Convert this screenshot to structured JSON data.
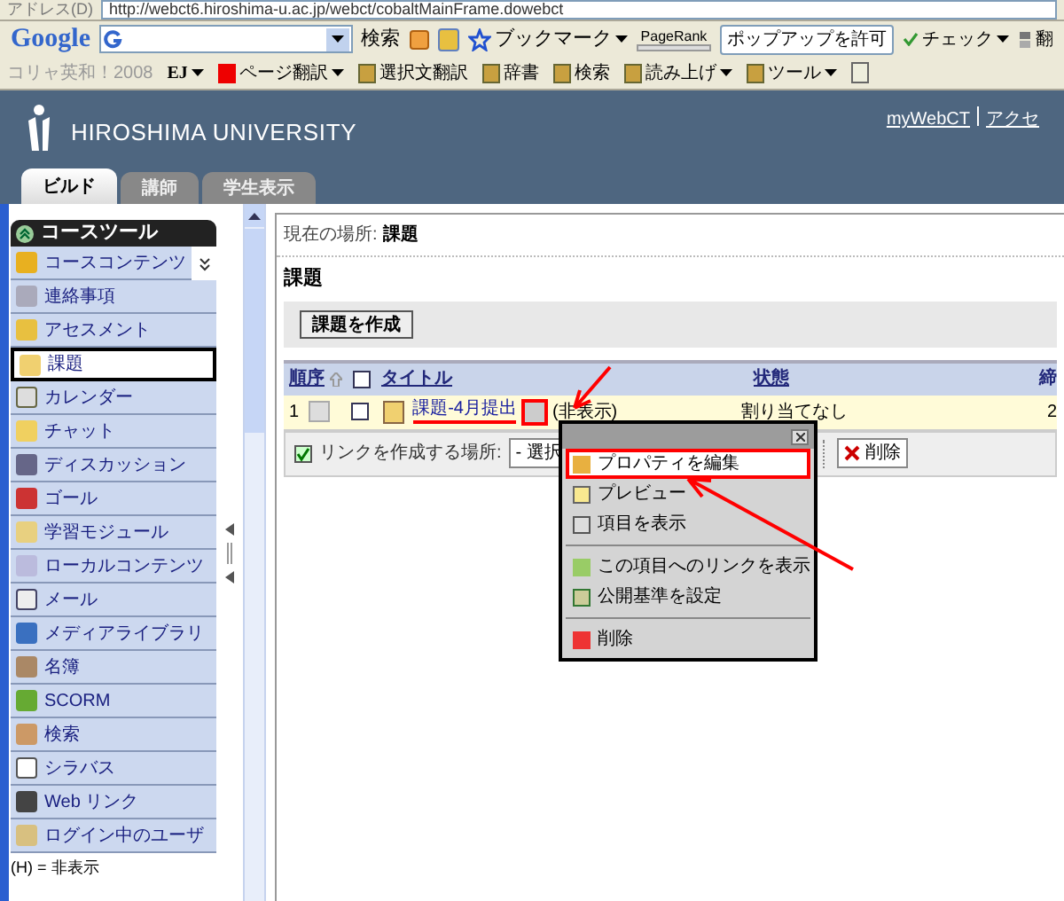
{
  "browser": {
    "address_label": "アドレス(D)",
    "url": "http://webct6.hiroshima-u.ac.jp/webct/cobaltMainFrame.dowebct"
  },
  "google_toolbar": {
    "logo": "Google",
    "search_button": "検索",
    "bookmarks": "ブックマーク",
    "pagerank": "PageRank",
    "popup_button": "ポップアップを許可",
    "check": "チェック",
    "translate": "翻"
  },
  "translation_toolbar": {
    "brand": "コリャ英和！2008",
    "items": [
      {
        "label": "EJ",
        "dropdown": true
      },
      {
        "label": "ページ翻訳",
        "dropdown": true
      },
      {
        "label": "選択文翻訳",
        "dropdown": false
      },
      {
        "label": "辞書",
        "dropdown": false
      },
      {
        "label": "検索",
        "dropdown": false
      },
      {
        "label": "読み上げ",
        "dropdown": true
      },
      {
        "label": "ツール",
        "dropdown": true
      }
    ]
  },
  "header": {
    "title": "HIROSHIMA UNIVERSITY",
    "links": [
      "myWebCT",
      "アクセ"
    ]
  },
  "tabs": [
    {
      "label": "ビルド",
      "selected": true
    },
    {
      "label": "講師",
      "selected": false
    },
    {
      "label": "学生表示",
      "selected": false
    }
  ],
  "sidebar": {
    "title": "コースツール",
    "items": [
      {
        "label": "コースコンテンツ",
        "selected": false
      },
      {
        "label": "連絡事項",
        "selected": false
      },
      {
        "label": "アセスメント",
        "selected": false
      },
      {
        "label": "課題",
        "selected": true
      },
      {
        "label": "カレンダー",
        "selected": false
      },
      {
        "label": "チャット",
        "selected": false
      },
      {
        "label": "ディスカッション",
        "selected": false
      },
      {
        "label": "ゴール",
        "selected": false
      },
      {
        "label": "学習モジュール",
        "selected": false
      },
      {
        "label": "ローカルコンテンツ",
        "selected": false
      },
      {
        "label": "メール",
        "selected": false
      },
      {
        "label": "メディアライブラリ",
        "selected": false
      },
      {
        "label": "名簿",
        "selected": false
      },
      {
        "label": "SCORM",
        "selected": false
      },
      {
        "label": "検索",
        "selected": false
      },
      {
        "label": "シラバス",
        "selected": false
      },
      {
        "label": "Web リンク",
        "selected": false
      },
      {
        "label": "ログイン中のユーザ",
        "selected": false
      }
    ],
    "legend": "(H) = 非表示"
  },
  "content": {
    "breadcrumb_label": "現在の場所:",
    "breadcrumb_current": "課題",
    "heading": "課題",
    "create_button": "課題を作成",
    "columns": [
      "順序",
      "タイトル",
      "状態",
      "締"
    ],
    "all_checked": false,
    "rows": [
      {
        "order": "1",
        "checked": false,
        "title": "課題-4月提出",
        "visibility": "(非表示)",
        "status": "割り当てなし",
        "column_4": "2"
      }
    ],
    "footer": {
      "link_label": "リンクを作成する場所:",
      "select_value": "- 選択",
      "delete_button": "削除"
    }
  },
  "context_menu": {
    "groups": [
      [
        {
          "label": "プロパティを編集",
          "selected": true
        },
        {
          "label": "プレビュー",
          "selected": false
        },
        {
          "label": "項目を表示",
          "selected": false
        }
      ],
      [
        {
          "label": "この項目へのリンクを表示",
          "selected": false
        },
        {
          "label": "公開基準を設定",
          "selected": false
        }
      ],
      [
        {
          "label": "削除",
          "selected": false
        }
      ]
    ]
  }
}
